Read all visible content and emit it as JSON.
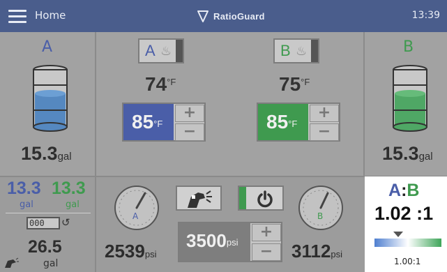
{
  "header": {
    "home_label": "Home",
    "brand": "RatioGuard",
    "time": "13:39"
  },
  "tank_a": {
    "label": "A",
    "quantity": "15.3",
    "unit": "gal"
  },
  "tank_b": {
    "label": "B",
    "quantity": "15.3",
    "unit": "gal"
  },
  "heater_a": {
    "button_label": "A",
    "actual_temp": "74",
    "setpoint": "85",
    "unit": "°F"
  },
  "heater_b": {
    "button_label": "B",
    "actual_temp": "75",
    "setpoint": "85",
    "unit": "°F"
  },
  "totals": {
    "a_value": "13.3",
    "a_unit": "gal",
    "b_value": "13.3",
    "b_unit": "gal",
    "counter_text": "000",
    "total_value": "26.5",
    "total_unit": "gal"
  },
  "pressure": {
    "a_label": "A",
    "b_label": "B",
    "a_value": "2539",
    "b_value": "3112",
    "setpoint": "3500",
    "unit": "psi"
  },
  "ratio": {
    "a": "A",
    "colon": ":",
    "b": "B",
    "value": "1.02",
    "suffix": ":1",
    "target": "1.00:1"
  },
  "colors": {
    "a_blue": "#4a5ea8",
    "b_green": "#3f9a4f",
    "header": "#4a5d8c",
    "panel": "#a2a2a2"
  }
}
